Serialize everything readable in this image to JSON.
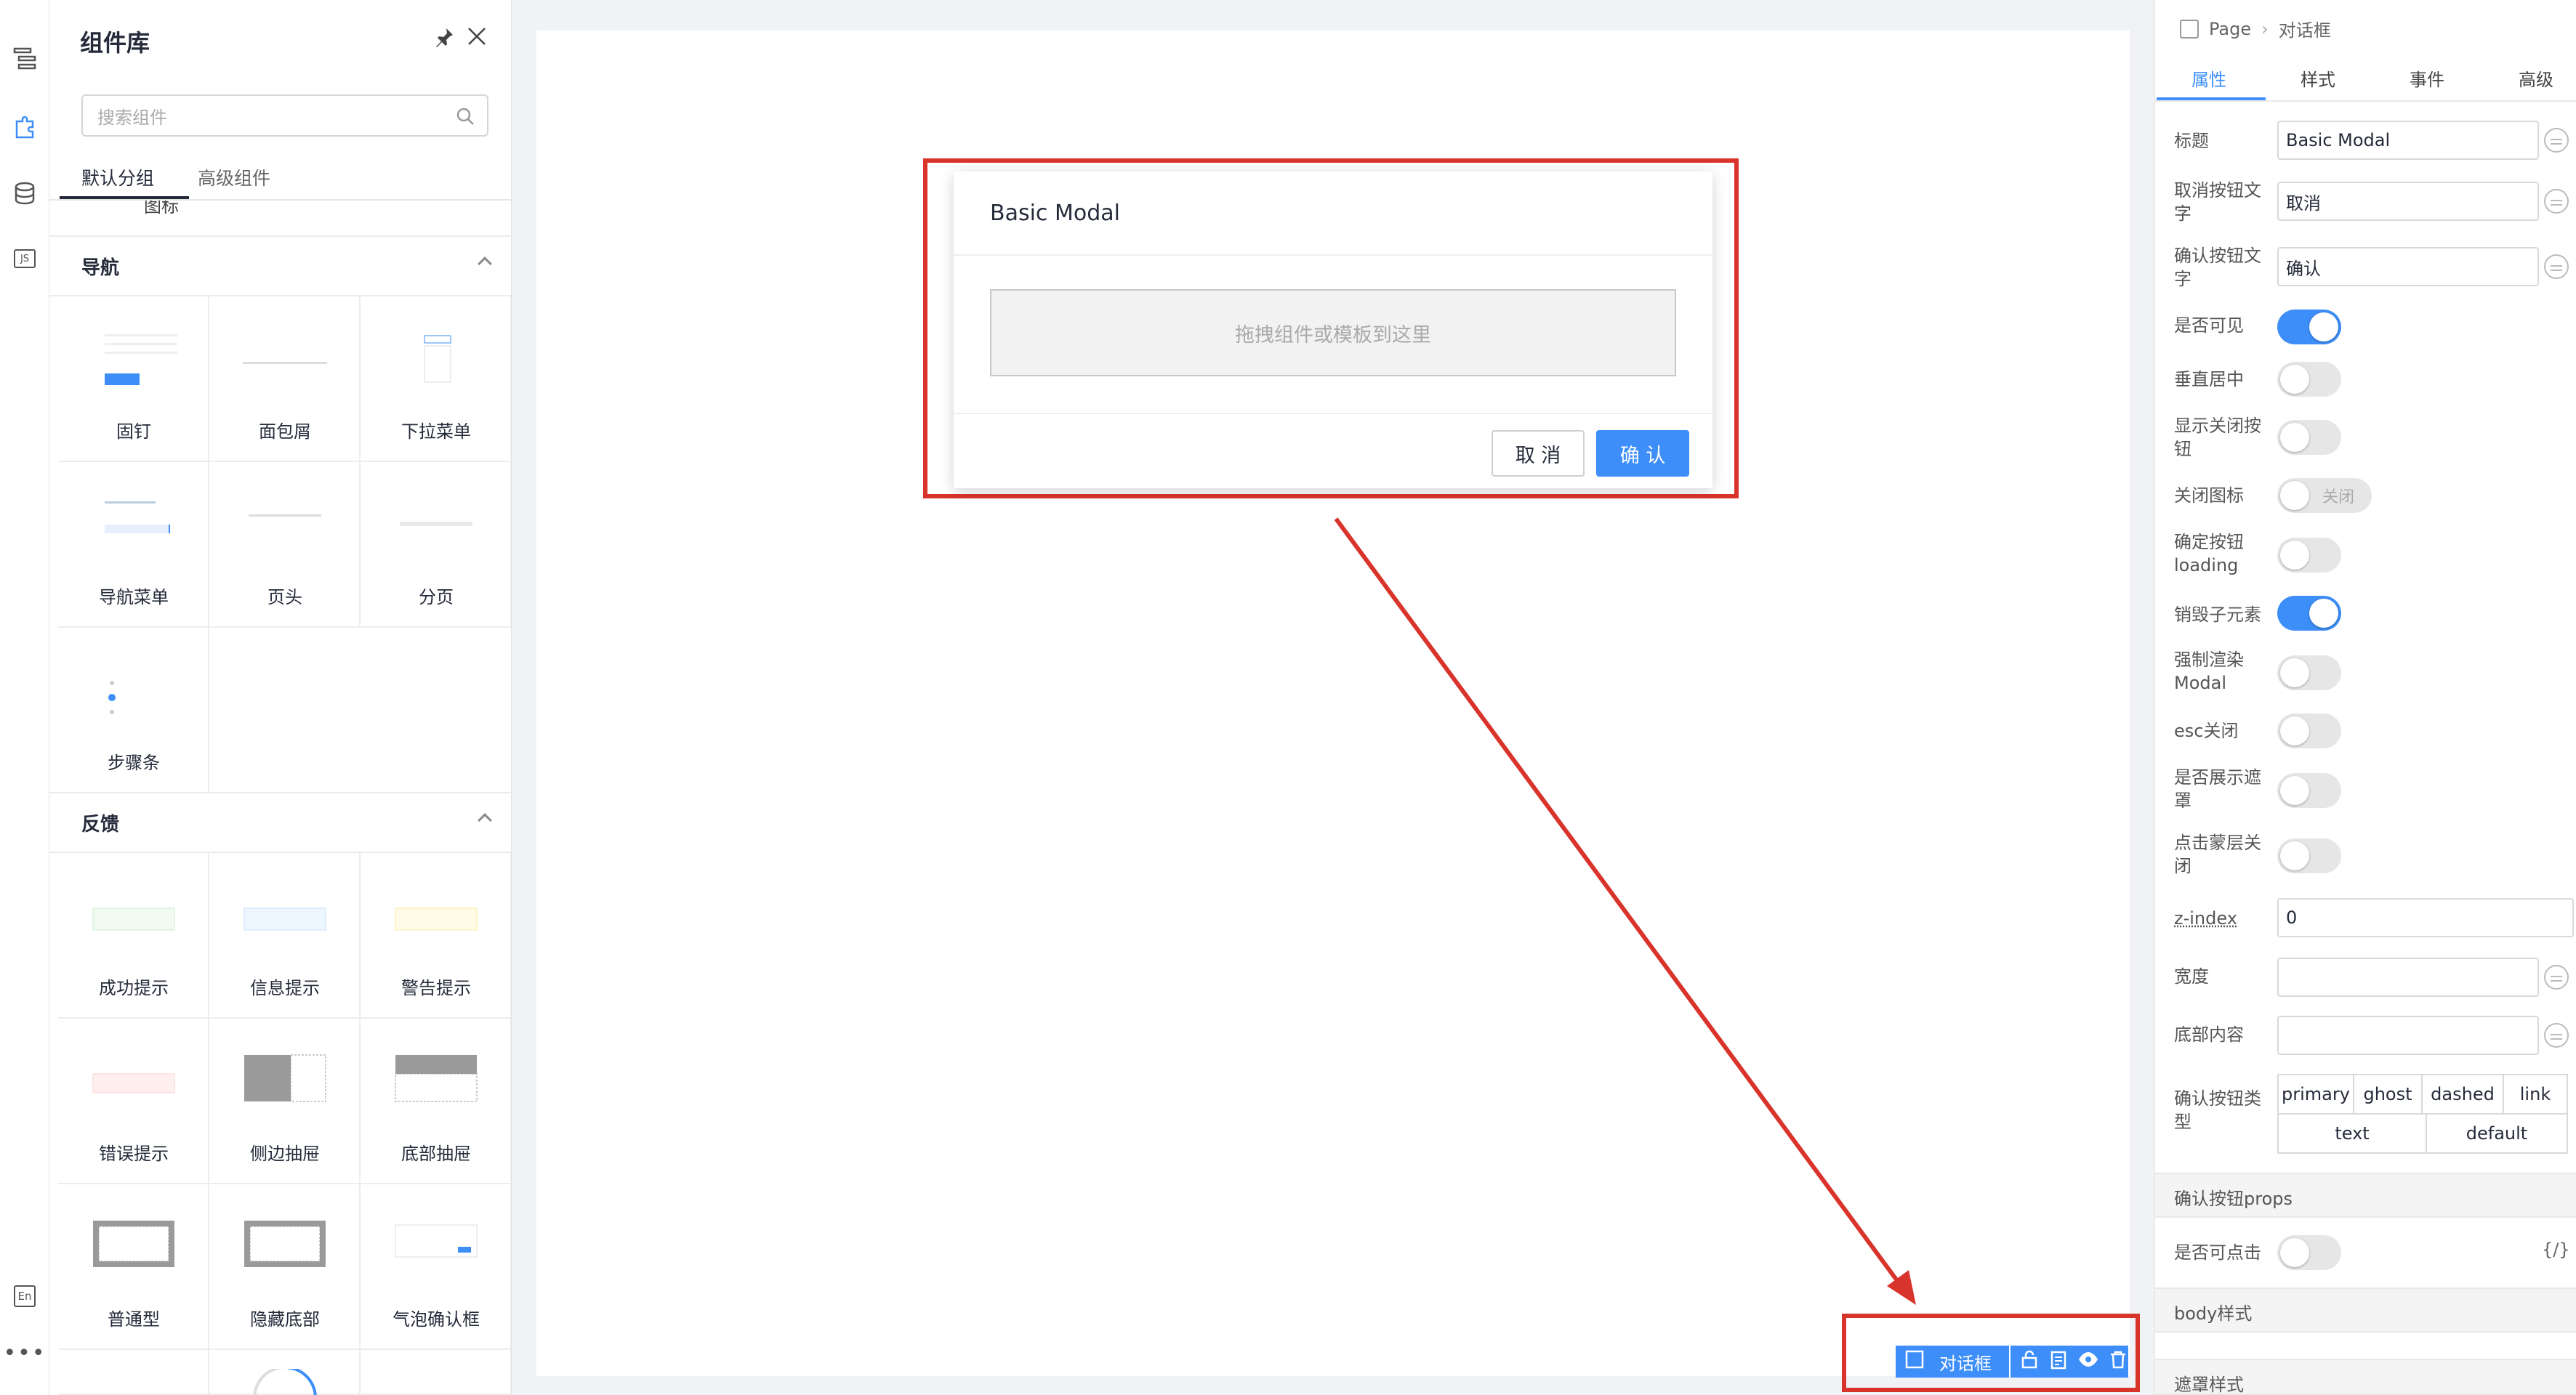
{
  "rail": {
    "icons": [
      "outline-icon",
      "component-icon",
      "datasource-icon",
      "js-icon",
      "language-icon",
      "more-icon"
    ],
    "lang_label": "En",
    "js_label": "JS"
  },
  "library": {
    "title": "组件库",
    "search_placeholder": "搜索组件",
    "tabs": [
      "默认分组",
      "高级组件"
    ],
    "cut_label": "图标",
    "nav_section": {
      "title": "导航",
      "items": [
        "固钉",
        "面包屑",
        "下拉菜单",
        "导航菜单",
        "页头",
        "分页",
        "步骤条"
      ]
    },
    "feedback_section": {
      "title": "反馈",
      "items": [
        "成功提示",
        "信息提示",
        "警告提示",
        "错误提示",
        "侧边抽屉",
        "底部抽屉",
        "普通型",
        "隐藏底部",
        "气泡确认框"
      ]
    }
  },
  "canvas": {
    "modal": {
      "title": "Basic Modal",
      "dropzone": "拖拽组件或模板到这里",
      "cancel": "取 消",
      "ok": "确 认"
    },
    "selection_bar": {
      "label": "对话框"
    }
  },
  "props": {
    "breadcrumb": [
      "Page",
      "对话框"
    ],
    "tabs": [
      "属性",
      "样式",
      "事件",
      "高级"
    ],
    "active_tab": "属性",
    "fields": {
      "title_label": "标题",
      "title_value": "Basic Modal",
      "cancel_label": "取消按钮文字",
      "cancel_value": "取消",
      "ok_label": "确认按钮文字",
      "ok_value": "确认",
      "visible_label": "是否可见",
      "centered_label": "垂直居中",
      "closable_label": "显示关闭按钮",
      "closeicon_label": "关闭图标",
      "closeicon_text": "关闭",
      "loading_label": "确定按钮loading",
      "destroy_label": "销毁子元素",
      "force_label": "强制渲染Modal",
      "esc_label": "esc关闭",
      "mask_label": "是否展示遮罩",
      "maskclose_label": "点击蒙层关闭",
      "zindex_label": "z-index",
      "zindex_value": "0",
      "width_label": "宽度",
      "footer_label": "底部内容",
      "oktype_label": "确认按钮类型",
      "oktype_options": [
        "primary",
        "ghost",
        "dashed",
        "link",
        "text",
        "default"
      ]
    },
    "section_okprops": "确认按钮props",
    "clickable_label": "是否可点击",
    "code_label": "{/}",
    "section_body": "body样式",
    "section_mask": "遮罩样式"
  },
  "switch_states": {
    "visible": true,
    "centered": false,
    "closable": false,
    "closeicon": false,
    "loading": false,
    "destroy": true,
    "force": false,
    "esc": false,
    "mask": false,
    "maskclose": false,
    "clickable": false
  },
  "colors": {
    "accent": "#3d8ef8",
    "highlight": "#d9342b"
  }
}
